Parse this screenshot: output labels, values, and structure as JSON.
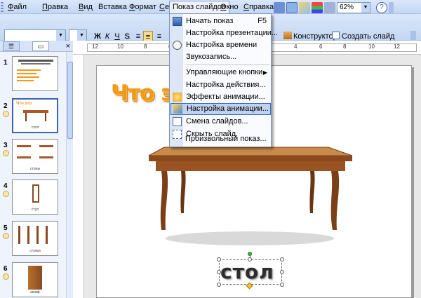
{
  "menubar": {
    "items": [
      {
        "id": "file",
        "label": "Файл",
        "acc": "Ф",
        "rest": "айл"
      },
      {
        "id": "edit",
        "label": "Правка",
        "acc": "П",
        "rest": "равка"
      },
      {
        "id": "view",
        "label": "Вид",
        "acc": "В",
        "rest": "ид"
      },
      {
        "id": "insert",
        "label": "Вставка",
        "acc": "",
        "rest": "Вставка"
      },
      {
        "id": "format",
        "label": "Формат",
        "acc": "Ф",
        "rest": "ормат"
      },
      {
        "id": "service",
        "label": "Сервис",
        "acc": "С",
        "rest": "ервис"
      },
      {
        "id": "slideshow",
        "label": "Показ слайдов",
        "acc": "",
        "rest": "Показ слайдов"
      },
      {
        "id": "window",
        "label": "Окно",
        "acc": "О",
        "rest": "кно"
      },
      {
        "id": "help",
        "label": "Справка",
        "acc": "С",
        "rest": "правка"
      }
    ],
    "open_menu": "Показ слайдов"
  },
  "toolbar": {
    "zoom": "62%",
    "bold": "Ж",
    "italic": "К",
    "underline": "Ч",
    "shadow": "S",
    "designer": "Конструктор",
    "new_slide": "Создать слайд"
  },
  "slideshow_menu": {
    "items": [
      {
        "id": "start",
        "label": "Начать показ",
        "shortcut": "F5",
        "icon": "projector-icon"
      },
      {
        "id": "setup",
        "label": "Настройка презентации...",
        "icon": ""
      },
      {
        "id": "rehearse",
        "label": "Настройка времени",
        "icon": "stopwatch-icon"
      },
      {
        "id": "record",
        "label": "Звукозапись...",
        "icon": ""
      },
      {
        "id": "action-buttons",
        "label": "Управляющие кнопки",
        "submenu": true,
        "icon": ""
      },
      {
        "id": "action-settings",
        "label": "Настройка действия...",
        "icon": ""
      },
      {
        "id": "animation-effects",
        "label": "Эффекты анимации...",
        "icon": "animation-effects-icon"
      },
      {
        "id": "custom-animation",
        "label": "Настройка анимации...",
        "icon": "custom-animation-icon",
        "highlighted": true
      },
      {
        "id": "transition",
        "label": "Смена слайдов...",
        "icon": "transition-icon"
      },
      {
        "id": "hide-slide",
        "label": "Скрыть слайд",
        "icon": "hide-slide-icon"
      },
      {
        "id": "custom-show",
        "label": "Произвольный показ...",
        "icon": ""
      }
    ]
  },
  "slides_pane": {
    "close": "×",
    "slides": [
      {
        "number": "1",
        "caption": ""
      },
      {
        "number": "2",
        "caption": "стол",
        "selected": true
      },
      {
        "number": "3",
        "caption": "столы"
      },
      {
        "number": "4",
        "caption": "стул"
      },
      {
        "number": "5",
        "caption": "стулья"
      },
      {
        "number": "6",
        "caption": "шкаф"
      }
    ]
  },
  "slide": {
    "title": "Что это",
    "caption": "стол"
  },
  "ruler": {
    "numbers": [
      "12",
      "10",
      "8",
      "6",
      "4",
      "2",
      "0",
      "2",
      "4",
      "6",
      "8",
      "10",
      "12"
    ]
  },
  "colors": {
    "title_orange": "#f29a16",
    "menu_highlight": "#c1d2ee",
    "toolbar_blue": "#c3d6f3"
  }
}
